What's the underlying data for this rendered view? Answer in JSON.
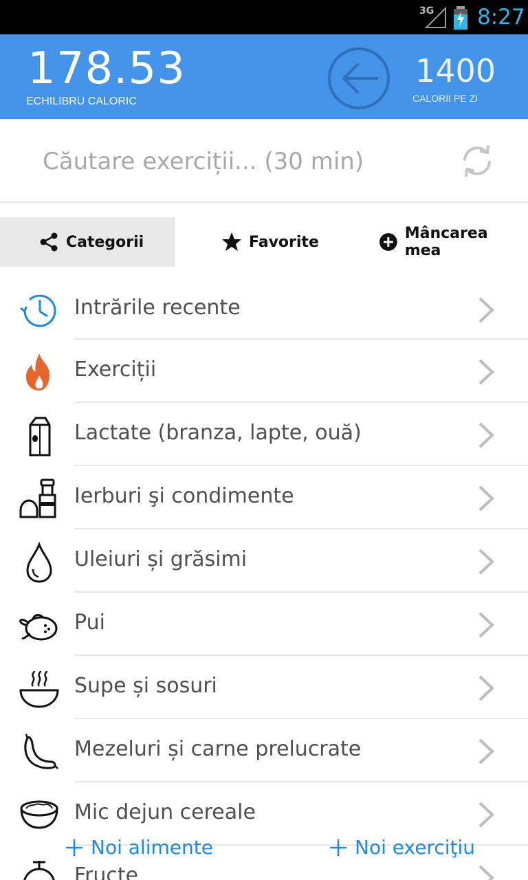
{
  "status_bar": {
    "network": "3G",
    "time": "8:27",
    "time_color": "#33b5e5"
  },
  "header": {
    "balance_value": "178.53",
    "balance_label": "ECHILIBRU CALORIC",
    "daily_calories_value": "1400",
    "daily_calories_label": "CALORII PE ZI",
    "background_color": "#4394e8",
    "back_icon": "arrow-left-circle-icon"
  },
  "search": {
    "placeholder": "Căutare exerciții... (30 min)",
    "value": "",
    "refresh_icon": "refresh-icon"
  },
  "tabs": [
    {
      "label": "Categorii",
      "icon": "share-icon",
      "active": true
    },
    {
      "label": "Favorite",
      "icon": "star-icon",
      "active": false
    },
    {
      "label": "Mâncarea mea",
      "icon": "plus-circle-icon",
      "active": false
    }
  ],
  "categories": [
    {
      "label": "Intrările recente",
      "icon": "history-clock-icon"
    },
    {
      "label": "Exerciții",
      "icon": "flame-icon"
    },
    {
      "label": "Lactate (branza, lapte, ouă)",
      "icon": "milk-carton-icon"
    },
    {
      "label": "Ierburi şi condimente",
      "icon": "salt-pepper-icon"
    },
    {
      "label": "Uleiuri și grăsimi",
      "icon": "oil-drop-icon"
    },
    {
      "label": "Pui",
      "icon": "chicken-icon"
    },
    {
      "label": "Supe și sosuri",
      "icon": "soup-bowl-icon"
    },
    {
      "label": "Mezeluri și carne prelucrate",
      "icon": "sausage-icon"
    },
    {
      "label": "Mic dejun cereale",
      "icon": "cereal-bowl-icon"
    },
    {
      "label": "Fructe",
      "icon": "fruit-icon"
    }
  ],
  "bottom_actions": {
    "add_food_label": "Noi alimente",
    "add_exercise_label": "Noi exerciţiu",
    "accent_color": "#1e88e5"
  }
}
